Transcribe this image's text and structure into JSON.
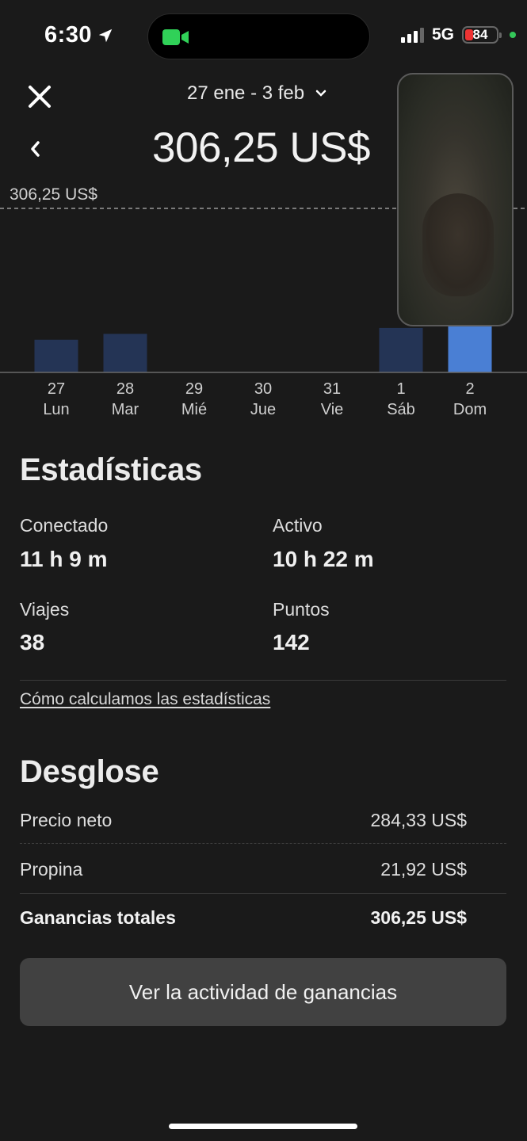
{
  "status_bar": {
    "time": "6:30",
    "network": "5G",
    "battery_level": "84",
    "battery_color": "#e33333",
    "location_icon": "location-arrow-icon",
    "camera_icon": "facetime-video-icon"
  },
  "header": {
    "close_icon": "close-icon",
    "date_range": "27 ene - 3 feb",
    "dropdown_icon": "chevron-down-icon",
    "back_icon": "chevron-left-icon",
    "total_earnings": "306,25 US$"
  },
  "chart_data": {
    "type": "bar",
    "reference_label": "306,25 US$",
    "reference_value": 306.25,
    "categories": [
      "27\nLun",
      "28\nMar",
      "29\nMié",
      "30\nJue",
      "31\nVie",
      "1\nSáb",
      "2\nDom"
    ],
    "day_numbers": [
      "27",
      "28",
      "29",
      "30",
      "31",
      "1",
      "2"
    ],
    "day_names": [
      "Lun",
      "Mar",
      "Mié",
      "Jue",
      "Vie",
      "Sáb",
      "Dom"
    ],
    "values": [
      61,
      72,
      0,
      0,
      0,
      83,
      101
    ],
    "ylim": [
      0,
      306.25
    ],
    "highlight_index": 6,
    "bar_color": "#243455",
    "highlight_color": "#4a7fd4"
  },
  "stats": {
    "title": "Estadísticas",
    "items": [
      {
        "label": "Conectado",
        "value": "11 h 9 m"
      },
      {
        "label": "Activo",
        "value": "10 h 22 m"
      },
      {
        "label": "Viajes",
        "value": "38"
      },
      {
        "label": "Puntos",
        "value": "142"
      }
    ],
    "link": "Cómo calculamos las estadísticas"
  },
  "breakdown": {
    "title": "Desglose",
    "rows": [
      {
        "label": "Precio neto",
        "value": "284,33 US$"
      },
      {
        "label": "Propina",
        "value": "21,92 US$"
      },
      {
        "label": "Ganancias totales",
        "value": "306,25 US$"
      }
    ]
  },
  "action_button": "Ver la actividad de ganancias"
}
